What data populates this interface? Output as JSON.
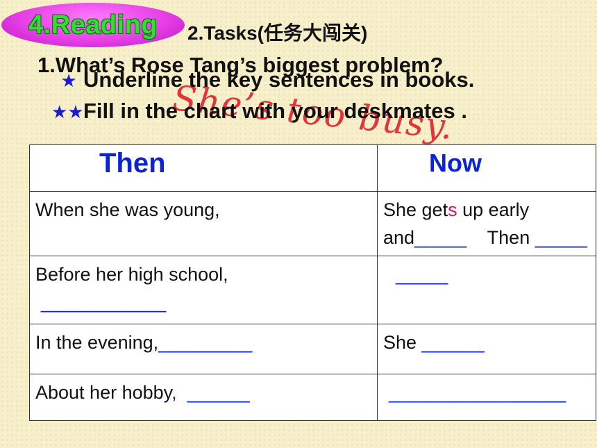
{
  "badge": {
    "label": "4.Reading"
  },
  "tasks_title": "2.Tasks(任务大闯关)",
  "question": "1.What’s Rose Tang’s biggest problem?",
  "answer": "She’s too busy.",
  "instructions": [
    {
      "stars": "★",
      "text": "Underline the key sentences  in books."
    },
    {
      "stars": "★★",
      "text": "Fill in the chart with your deskmates ."
    }
  ],
  "table": {
    "headers": [
      "Then",
      "Now"
    ],
    "rows": [
      {
        "then": "When she was  young,",
        "then_blank": "",
        "now_a": "She get",
        "now_red": "s",
        "now_b": " up early and",
        "now_blank1": "_____",
        "now_mid": "    Then ",
        "now_blank2": "_____"
      },
      {
        "then": "Before her high school,",
        "then_blank": "____________",
        "now_blank1": "_____"
      },
      {
        "then": "In the evening,",
        "then_blank": "_________",
        "now_a": "She ",
        "now_blank1": "______"
      },
      {
        "then": "About her hobby",
        "then_comma": ",",
        "then_blank": "______",
        "now_blank1": "_________________"
      }
    ]
  },
  "colors": {
    "badge": "#e640e6",
    "badge_text": "#3ad83a",
    "stars": "#1a1ad8",
    "header": "#0b22d6",
    "answer": "#e0202a"
  }
}
